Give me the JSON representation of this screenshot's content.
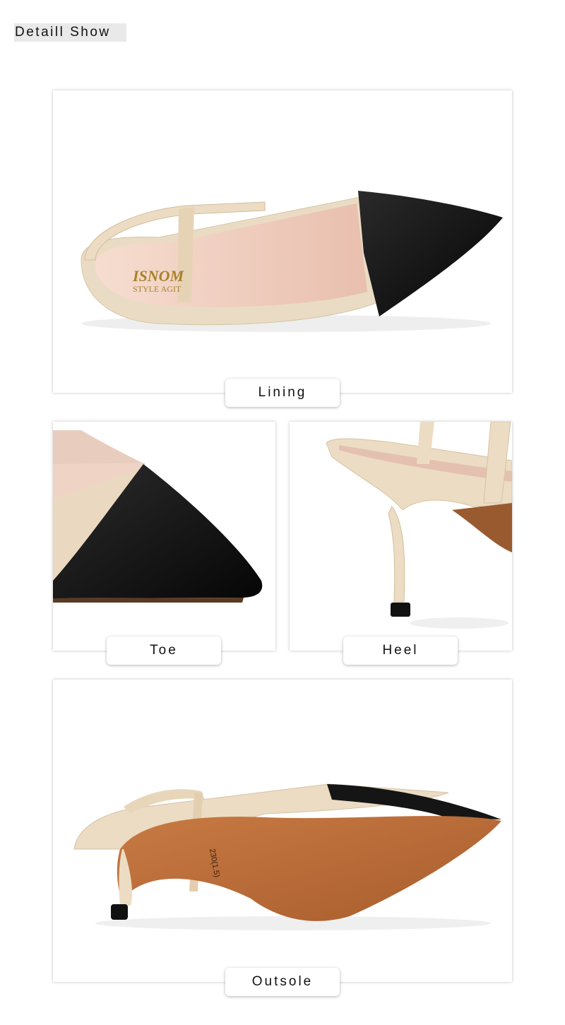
{
  "header": {
    "title": "Detaill Show"
  },
  "sections": {
    "lining": {
      "label": "Lining",
      "insole_brand": "ISNOM",
      "insole_sub": "STYLE AGIT"
    },
    "toe": {
      "label": "Toe"
    },
    "heel": {
      "label": "Heel"
    },
    "outsole": {
      "label": "Outsole",
      "size_mark": "230(1.5)"
    }
  },
  "colors": {
    "nude_leather": "#ecdcc3",
    "black_leather": "#141414",
    "insole_pink": "#efcfbf",
    "outsole_brown": "#b86a38",
    "panel_border": "#dcdcdc"
  }
}
